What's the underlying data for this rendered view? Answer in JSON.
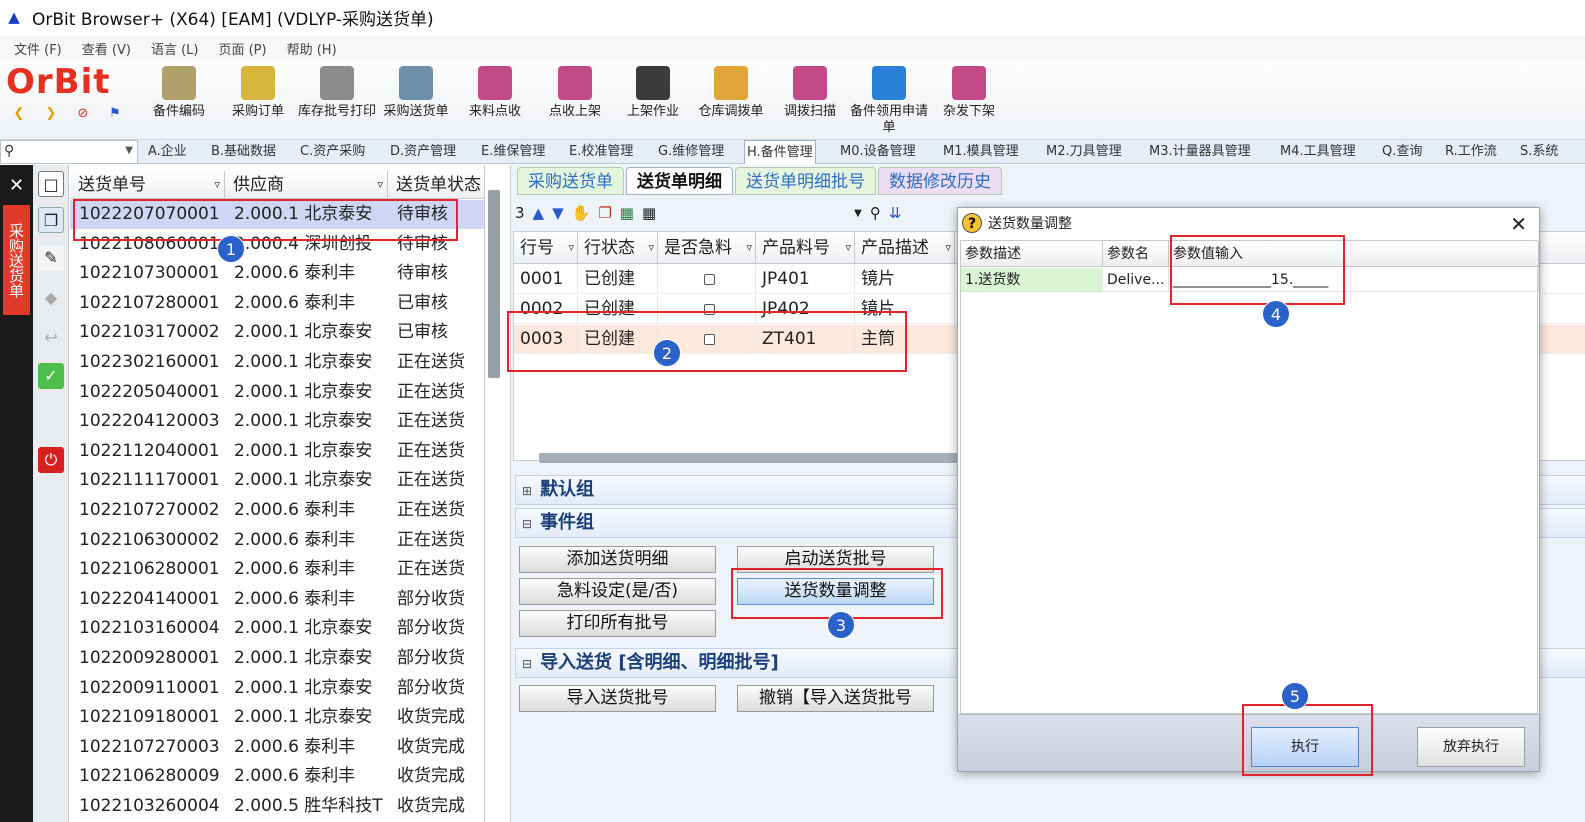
{
  "window": {
    "title": "OrBit Browser+ (X64) [EAM] (VDLYP-采购送货单)"
  },
  "menu": [
    "文件 (F)",
    "查看 (V)",
    "语言 (L)",
    "页面 (P)",
    "帮助 (H)"
  ],
  "logo": {
    "text": "OrBit"
  },
  "toolbar": [
    {
      "label": "备件编码",
      "color": "#b0a06a"
    },
    {
      "label": "采购订单",
      "color": "#d8b53c"
    },
    {
      "label": "库存批号打印",
      "color": "#8c8c8c"
    },
    {
      "label": "采购送货单",
      "color": "#6f8fa8"
    },
    {
      "label": "来料点收",
      "color": "#c24a86"
    },
    {
      "label": "点收上架",
      "color": "#c24a86"
    },
    {
      "label": "上架作业",
      "color": "#3b3b3b"
    },
    {
      "label": "仓库调拨单",
      "color": "#e2a53a"
    },
    {
      "label": "调拨扫描",
      "color": "#c24a86"
    },
    {
      "label": "备件领用申请单",
      "color": "#2a7fd6"
    },
    {
      "label": "杂发下架",
      "color": "#c24a86"
    }
  ],
  "modules": [
    "A.企业",
    "B.基础数据",
    "C.资产采购",
    "D.资产管理",
    "E.维保管理",
    "E.校准管理",
    "G.维修管理",
    "H.备件管理",
    "M0.设备管理",
    "M1.模具管理",
    "M2.刀具管理",
    "M3.计量器具管理",
    "M4.工具管理",
    "Q.查询",
    "R.工作流",
    "S.系统"
  ],
  "sidebar_label": "采购送货单",
  "left_table": {
    "headers": [
      "送货单号",
      "供应商",
      "送货单状态"
    ],
    "rows": [
      [
        "1022207070001",
        "2.000.1 北京泰安",
        "待审核"
      ],
      [
        "1022108060001",
        "2.000.4 深圳创投",
        "待审核"
      ],
      [
        "1022107300001",
        "2.000.6 泰利丰",
        "待审核"
      ],
      [
        "1022107280001",
        "2.000.6 泰利丰",
        "已审核"
      ],
      [
        "1022103170002",
        "2.000.1 北京泰安",
        "已审核"
      ],
      [
        "1022302160001",
        "2.000.1 北京泰安",
        "正在送货"
      ],
      [
        "1022205040001",
        "2.000.1 北京泰安",
        "正在送货"
      ],
      [
        "1022204120003",
        "2.000.1 北京泰安",
        "正在送货"
      ],
      [
        "1022112040001",
        "2.000.1 北京泰安",
        "正在送货"
      ],
      [
        "1022111170001",
        "2.000.1 北京泰安",
        "正在送货"
      ],
      [
        "1022107270002",
        "2.000.6 泰利丰",
        "正在送货"
      ],
      [
        "1022106300002",
        "2.000.6 泰利丰",
        "正在送货"
      ],
      [
        "1022106280001",
        "2.000.6 泰利丰",
        "正在送货"
      ],
      [
        "1022204140001",
        "2.000.6 泰利丰",
        "部分收货"
      ],
      [
        "1022103160004",
        "2.000.1 北京泰安",
        "部分收货"
      ],
      [
        "1022009280001",
        "2.000.1 北京泰安",
        "部分收货"
      ],
      [
        "1022009110001",
        "2.000.1 北京泰安",
        "部分收货"
      ],
      [
        "1022109180001",
        "2.000.1 北京泰安",
        "收货完成"
      ],
      [
        "1022107270003",
        "2.000.6 泰利丰",
        "收货完成"
      ],
      [
        "1022106280009",
        "2.000.6 泰利丰",
        "收货完成"
      ],
      [
        "1022103260004",
        "2.000.5 胜华科技T",
        "收货完成"
      ]
    ]
  },
  "tabs": [
    "采购送货单",
    "送货单明细",
    "送货单明细批号",
    "数据修改历史"
  ],
  "subbar": {
    "count": "3"
  },
  "detail_table": {
    "headers": [
      "行号",
      "行状态",
      "是否急料",
      "产品料号",
      "产品描述"
    ],
    "rows": [
      [
        "0001",
        "已创建",
        "",
        "JP401",
        "镜片"
      ],
      [
        "0002",
        "已创建",
        "",
        "JP402",
        "镜片"
      ],
      [
        "0003",
        "已创建",
        "",
        "ZT401",
        "主筒"
      ]
    ]
  },
  "groups": {
    "default": "默认组",
    "events": "事件组",
    "import": "导入送货 [含明细、明细批号]"
  },
  "buttons": {
    "add_detail": "添加送货明细",
    "start_batch": "启动送货批号",
    "urgent": "急料设定(是/否)",
    "qty_adjust": "送货数量调整",
    "print_all": "打印所有批号",
    "import_batch": "导入送货批号",
    "undo_import": "撤销【导入送货批号"
  },
  "dialog": {
    "title": "送货数量调整",
    "headers": [
      "参数描述",
      "参数名",
      "参数值输入"
    ],
    "row": [
      "1.送货数",
      "Delive...",
      "______________15._____"
    ],
    "execute": "执行",
    "cancel": "放弃执行"
  },
  "badges": [
    "1",
    "2",
    "3",
    "4",
    "5"
  ]
}
